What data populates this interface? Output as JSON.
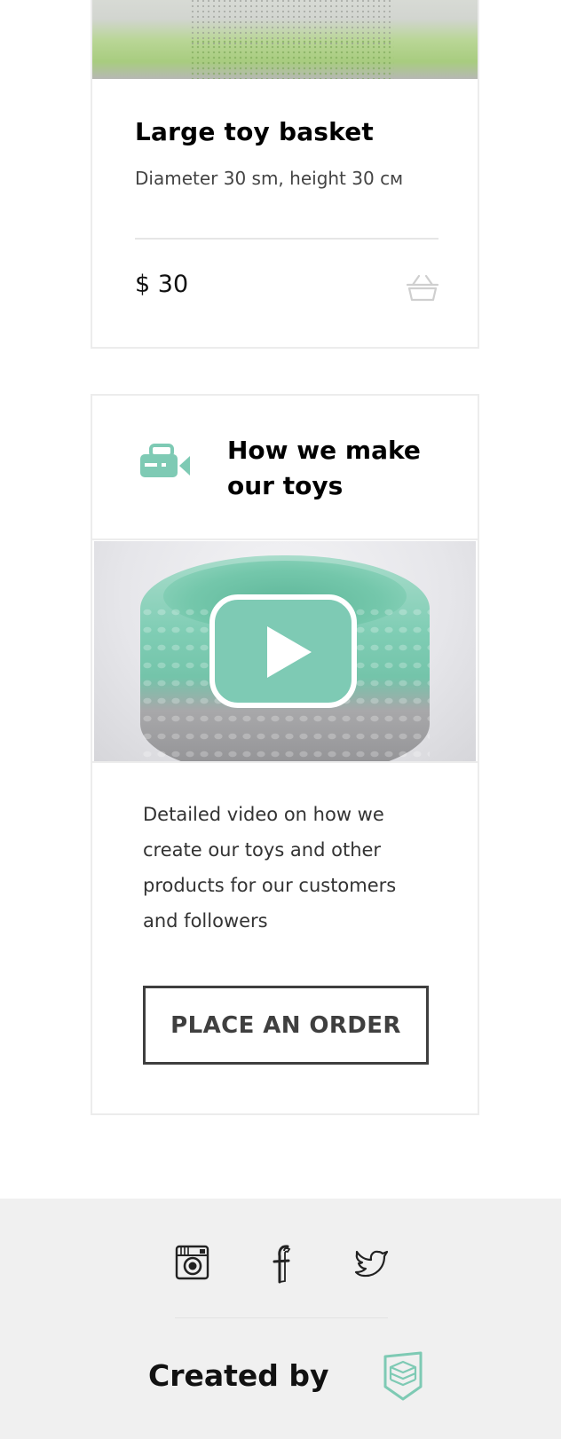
{
  "product": {
    "title": "Large toy basket",
    "description": "Diameter 30 sm, height 30 см",
    "price": "$ 30"
  },
  "video_section": {
    "title": "How we make our toys",
    "description": "Detailed video on how we create our toys and other products for our customers and followers",
    "order_button_label": "PLACE AN ORDER"
  },
  "footer": {
    "social_icons": [
      "instagram-icon",
      "facebook-icon",
      "twitter-icon"
    ],
    "created_by": "Created by"
  },
  "colors": {
    "accent": "#7ecab4",
    "button_border": "#3f3f3f",
    "footer_bg": "#f0f0f0"
  }
}
